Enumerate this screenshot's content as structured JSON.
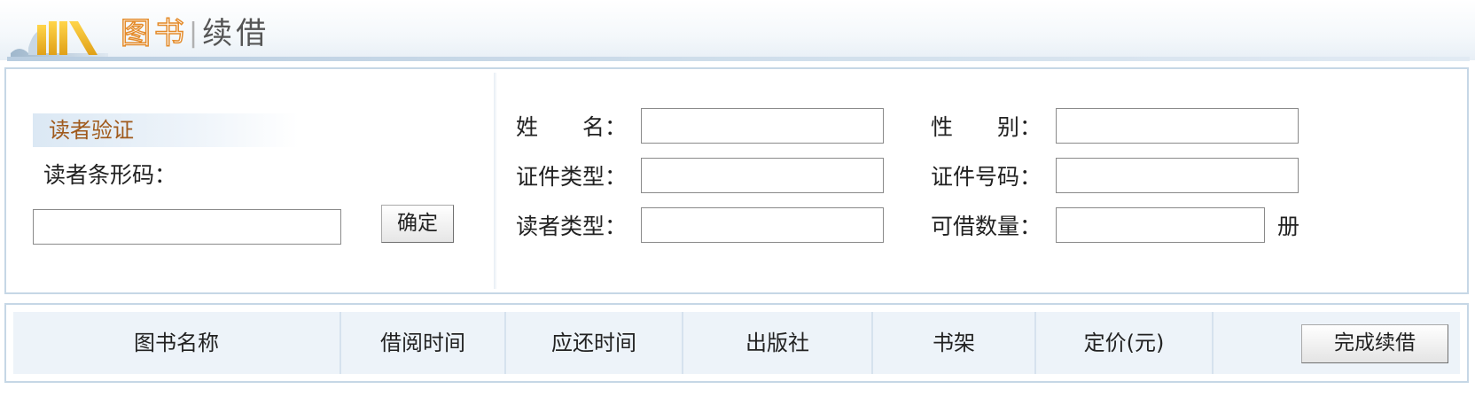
{
  "header": {
    "title_chars": [
      "图",
      "书",
      "续",
      "借"
    ],
    "title_separator": "|",
    "logo_icon": "books-icon",
    "accent_color": "#e48b2a"
  },
  "reader_verify": {
    "section_title": "读者验证",
    "barcode_label": "读者条形码：",
    "barcode_value": "",
    "confirm_label": "确定"
  },
  "reader_info": {
    "name_label": "姓　　名：",
    "name_value": "",
    "gender_label": "性　　别：",
    "gender_value": "",
    "id_type_label": "证件类型：",
    "id_type_value": "",
    "id_number_label": "证件号码：",
    "id_number_value": "",
    "reader_type_label": "读者类型：",
    "reader_type_value": "",
    "borrow_limit_label": "可借数量：",
    "borrow_limit_value": "",
    "borrow_limit_unit": "册"
  },
  "table": {
    "columns": [
      "图书名称",
      "借阅时间",
      "应还时间",
      "出版社",
      "书架",
      "定价(元)"
    ],
    "finish_label": "完成续借"
  }
}
